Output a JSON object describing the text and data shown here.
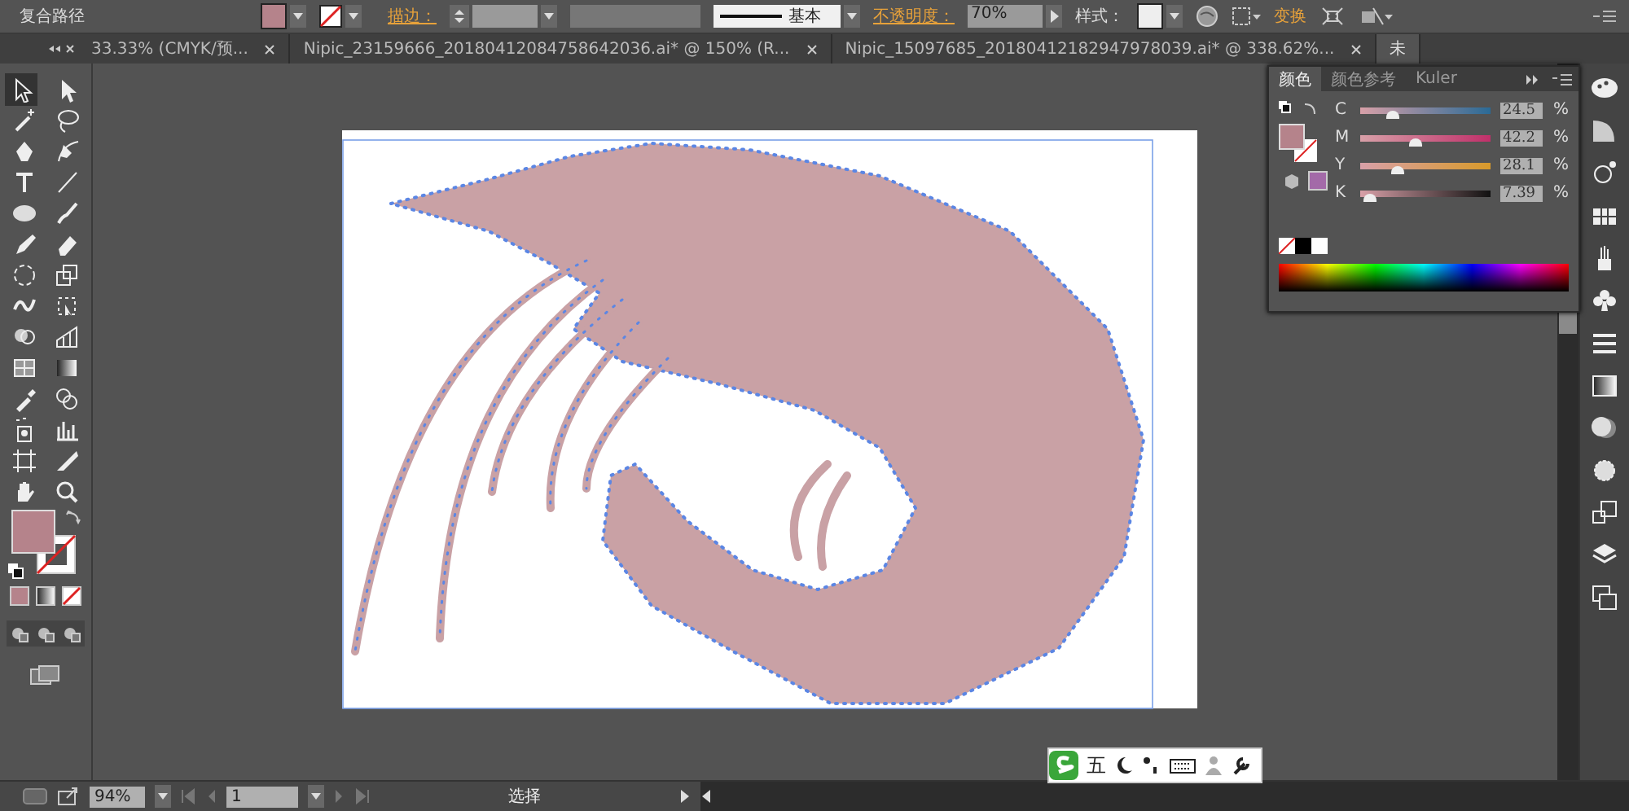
{
  "control_bar": {
    "object_type": "复合路径",
    "stroke_label": "描边：",
    "stroke_profile": "基本",
    "opacity_label": "不透明度：",
    "opacity_value": "70%",
    "style_label": "样式：",
    "transform_link": "变换"
  },
  "tabs": [
    {
      "label": "33.33% (CMYK/预...",
      "selected": false
    },
    {
      "label": "Nipic_23159666_20180412084758642036.ai* @ 150% (R...",
      "selected": false
    },
    {
      "label": "Nipic_15097685_20180412182947978039.ai* @ 338.62%...",
      "selected": false
    },
    {
      "label": "未",
      "selected": true
    }
  ],
  "color_panel": {
    "tabs": [
      {
        "label": "颜色",
        "selected": true
      },
      {
        "label": "颜色参考",
        "selected": false
      },
      {
        "label": "Kuler",
        "selected": false
      }
    ],
    "channels": [
      {
        "name": "C",
        "level": 0.25,
        "reading": "24.5",
        "unit": "%"
      },
      {
        "name": "M",
        "level": 0.42,
        "reading": "42.2",
        "unit": "%"
      },
      {
        "name": "Y",
        "level": 0.28,
        "reading": "28.1",
        "unit": "%"
      },
      {
        "name": "K",
        "level": 0.07,
        "reading": "7.39",
        "unit": "%"
      }
    ]
  },
  "status_bar": {
    "zoom": "94%",
    "page": "1",
    "tool": "选择"
  },
  "ime": {
    "mode": "五"
  }
}
